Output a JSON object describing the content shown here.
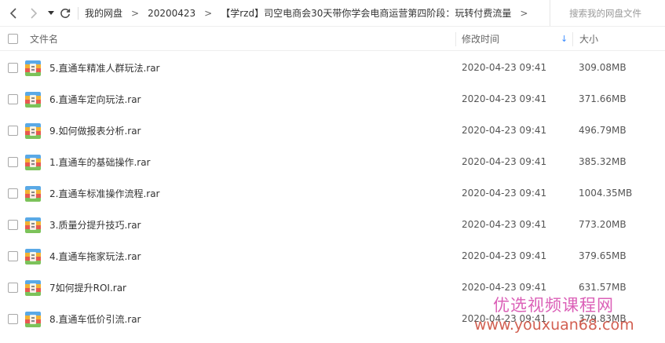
{
  "toolbar": {
    "back_icon": "chevron-left-icon",
    "forward_icon": "chevron-right-icon",
    "dropdown_icon": "triangle-down-icon",
    "refresh_icon": "refresh-icon",
    "separator": ">",
    "breadcrumbs": [
      {
        "label": "我的网盘"
      },
      {
        "label": "20200423"
      },
      {
        "label": "【学rzd】司空电商会30天带你学会电商运营第四阶段：玩转付费流量"
      }
    ],
    "trailing_separator": ">",
    "search_placeholder": "搜索我的网盘文件"
  },
  "header": {
    "name": "文件名",
    "modified": "修改时间",
    "size": "大小",
    "sort_indicator": "↓",
    "sort_color": "#3b8cff"
  },
  "files": [
    {
      "name": "5.直通车精准人群玩法.rar",
      "modified": "2020-04-23 09:41",
      "size": "309.08MB"
    },
    {
      "name": "6.直通车定向玩法.rar",
      "modified": "2020-04-23 09:41",
      "size": "371.66MB"
    },
    {
      "name": "9.如何做报表分析.rar",
      "modified": "2020-04-23 09:41",
      "size": "496.79MB"
    },
    {
      "name": "1.直通车的基础操作.rar",
      "modified": "2020-04-23 09:41",
      "size": "385.32MB"
    },
    {
      "name": "2.直通车标准操作流程.rar",
      "modified": "2020-04-23 09:41",
      "size": "1004.35MB"
    },
    {
      "name": "3.质量分提升技巧.rar",
      "modified": "2020-04-23 09:41",
      "size": "773.20MB"
    },
    {
      "name": "4.直通车拖家玩法.rar",
      "modified": "2020-04-23 09:41",
      "size": "379.65MB"
    },
    {
      "name": "7如何提升ROI.rar",
      "modified": "2020-04-23 09:41",
      "size": "631.57MB"
    },
    {
      "name": "8.直通车低价引流.rar",
      "modified": "2020-04-23 09:41",
      "size": "379.83MB"
    }
  ],
  "file_icon": "rar-archive-icon",
  "watermark": {
    "line1": "优选视频课程网",
    "line2": "www.youxuan68.com"
  }
}
